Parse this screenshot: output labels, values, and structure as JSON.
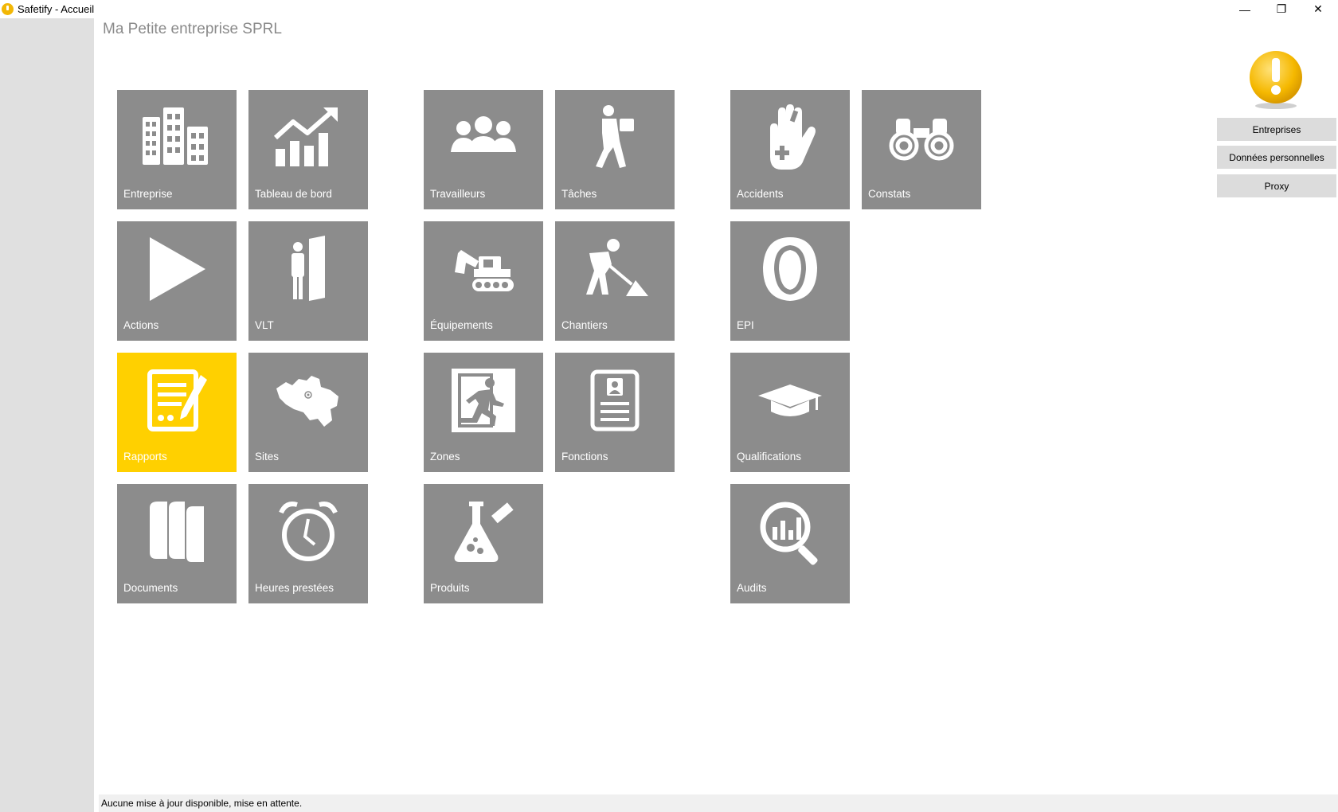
{
  "window": {
    "title": "Safetify - Accueil",
    "minimize_glyph": "—",
    "restore_glyph": "❐",
    "close_glyph": "✕"
  },
  "header": {
    "company": "Ma Petite entreprise SPRL"
  },
  "tiles": {
    "entreprise": {
      "label": "Entreprise",
      "icon": "buildings-icon"
    },
    "tableau_de_bord": {
      "label": "Tableau de bord",
      "icon": "chart-growth-icon"
    },
    "travailleurs": {
      "label": "Travailleurs",
      "icon": "people-group-icon"
    },
    "taches": {
      "label": "Tâches",
      "icon": "worker-carrying-icon"
    },
    "accidents": {
      "label": "Accidents",
      "icon": "injured-hand-icon"
    },
    "constats": {
      "label": "Constats",
      "icon": "binoculars-icon"
    },
    "actions": {
      "label": "Actions",
      "icon": "play-icon"
    },
    "vlt": {
      "label": "VLT",
      "icon": "person-door-icon"
    },
    "equipements": {
      "label": "Équipements",
      "icon": "excavator-icon"
    },
    "chantiers": {
      "label": "Chantiers",
      "icon": "worker-shovel-icon"
    },
    "epi": {
      "label": "EPI",
      "icon": "ear-protection-icon"
    },
    "rapports": {
      "label": "Rapports",
      "icon": "report-pencil-icon",
      "active": true
    },
    "sites": {
      "label": "Sites",
      "icon": "belgium-map-icon"
    },
    "zones": {
      "label": "Zones",
      "icon": "emergency-exit-icon"
    },
    "fonctions": {
      "label": "Fonctions",
      "icon": "id-card-icon"
    },
    "qualifications": {
      "label": "Qualifications",
      "icon": "graduation-cap-icon"
    },
    "documents": {
      "label": "Documents",
      "icon": "books-icon"
    },
    "heures_prestees": {
      "label": "Heures prestées",
      "icon": "alarm-clock-icon"
    },
    "produits": {
      "label": "Produits",
      "icon": "chemical-flask-icon"
    },
    "audits": {
      "label": "Audits",
      "icon": "magnifier-chart-icon"
    }
  },
  "right_panel": {
    "alert_icon": "warning-exclamation-icon",
    "buttons": {
      "entreprises": "Entreprises",
      "donnees": "Données personnelles",
      "proxy": "Proxy"
    }
  },
  "status": {
    "text": "Aucune mise à jour disponible, mise en attente."
  },
  "colors": {
    "tile": "#8c8c8c",
    "tile_active": "#ffd000",
    "sidebar": "#e0e0e0",
    "company_title": "#8a8a8a"
  }
}
